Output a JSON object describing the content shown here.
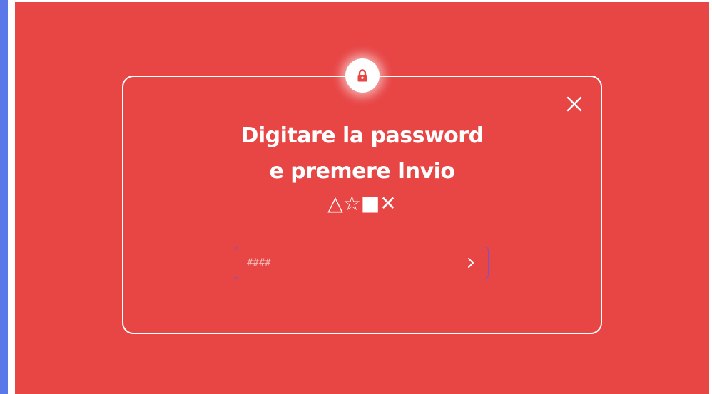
{
  "colors": {
    "panel_background": "#e84545",
    "left_strip": "#5b78e8",
    "foreground": "#ffffff",
    "input_border": "#7b53c8"
  },
  "dialog": {
    "lock_icon": "lock-icon",
    "close_icon": "close-icon",
    "title_line_1": "Digitare la password",
    "title_line_2": "e premere Invio",
    "symbols": "△☆■✕",
    "password_input": {
      "value": "",
      "placeholder": "####"
    },
    "submit_icon": "chevron-right-icon"
  }
}
